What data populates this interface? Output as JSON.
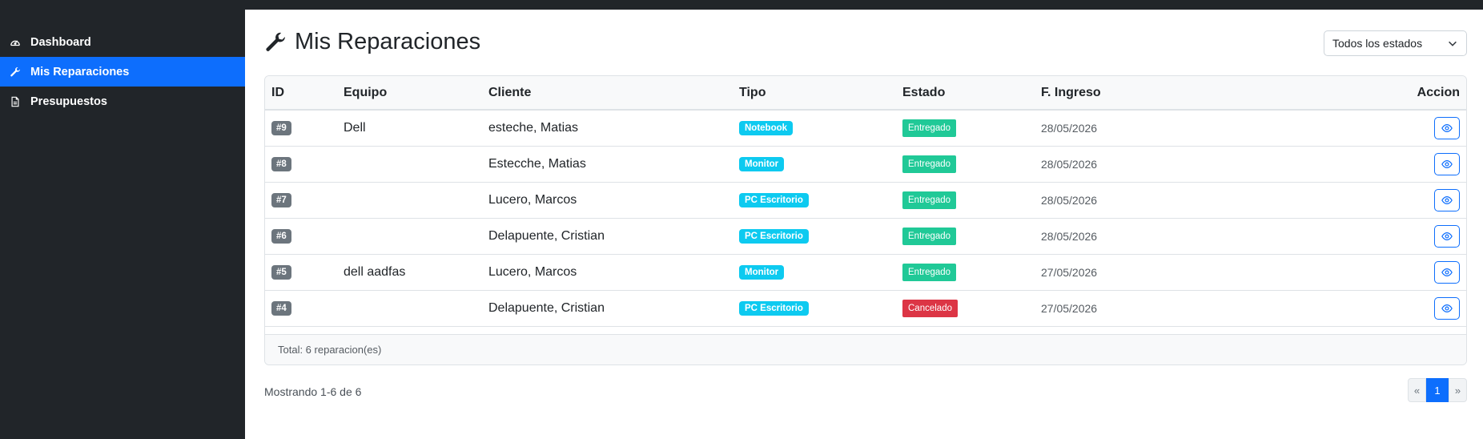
{
  "sidebar": {
    "items": [
      {
        "label": "Dashboard",
        "icon": "speedometer-icon",
        "active": false
      },
      {
        "label": "Mis Reparaciones",
        "icon": "wrench-icon",
        "active": true
      },
      {
        "label": "Presupuestos",
        "icon": "document-icon",
        "active": false
      }
    ]
  },
  "header": {
    "title": "Mis Reparaciones",
    "filter": {
      "selected": "Todos los estados"
    }
  },
  "table": {
    "columns": [
      "ID",
      "Equipo",
      "Cliente",
      "Tipo",
      "Estado",
      "F. Ingreso",
      "Accion"
    ],
    "rows": [
      {
        "id": "#9",
        "equipo": "Dell",
        "cliente": "esteche, Matias",
        "tipo": "Notebook",
        "estado": "Entregado",
        "fecha": "28/05/2026"
      },
      {
        "id": "#8",
        "equipo": "",
        "cliente": "Estecche, Matias",
        "tipo": "Monitor",
        "estado": "Entregado",
        "fecha": "28/05/2026"
      },
      {
        "id": "#7",
        "equipo": "",
        "cliente": "Lucero, Marcos",
        "tipo": "PC Escritorio",
        "estado": "Entregado",
        "fecha": "28/05/2026"
      },
      {
        "id": "#6",
        "equipo": "",
        "cliente": "Delapuente, Cristian",
        "tipo": "PC Escritorio",
        "estado": "Entregado",
        "fecha": "28/05/2026"
      },
      {
        "id": "#5",
        "equipo": "dell aadfas",
        "cliente": "Lucero, Marcos",
        "tipo": "Monitor",
        "estado": "Entregado",
        "fecha": "27/05/2026"
      },
      {
        "id": "#4",
        "equipo": "",
        "cliente": "Delapuente, Cristian",
        "tipo": "PC Escritorio",
        "estado": "Cancelado",
        "fecha": "27/05/2026"
      }
    ],
    "footer": "Total: 6 reparacion(es)"
  },
  "pagination": {
    "summary": "Mostrando 1-6 de 6",
    "prev": "«",
    "current": "1",
    "next": "»"
  },
  "colors": {
    "sidebar_bg": "#212529",
    "accent": "#0d6efd",
    "tipo_badge": "#0dcaf0",
    "entregado": "#20c997",
    "cancelado": "#dc3545",
    "id_badge": "#6c757d"
  }
}
